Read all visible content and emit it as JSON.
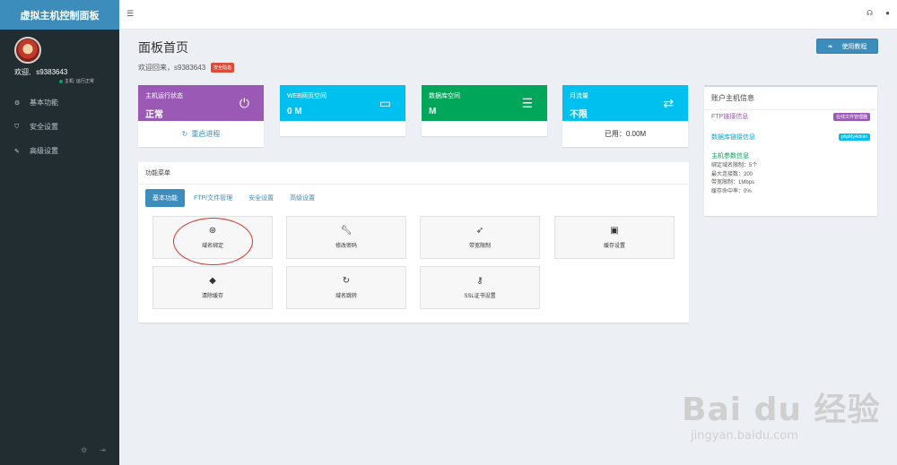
{
  "brand": "虚拟主机控制面板",
  "user": {
    "welcome": "欢迎,",
    "name": "s9383643",
    "status": "主机: 运行正常"
  },
  "sidebar": {
    "items": [
      {
        "label": "基本功能",
        "icon": "gears-icon"
      },
      {
        "label": "安全设置",
        "icon": "shield-icon"
      },
      {
        "label": "高级设置",
        "icon": "edit-icon"
      }
    ],
    "footer_icons": [
      "gear-icon",
      "logout-icon"
    ]
  },
  "header": {
    "menu_icon": "hamburger-icon",
    "right_icons": [
      "headset-icon",
      "user-icon"
    ]
  },
  "page": {
    "title": "面板首页",
    "subtitle": "欢迎回来，s9383643",
    "security_badge": "安全隐患",
    "tutorial_button": "使用教程"
  },
  "stats": [
    {
      "label": "主机运行状态",
      "value": "正常",
      "icon": "power-icon",
      "color": "#9b59b6",
      "footer": "重启进程"
    },
    {
      "label": "WEB网页空间",
      "value": "0 M",
      "icon": "hdd-icon",
      "color": "#00c0ef",
      "footer": ""
    },
    {
      "label": "数据库空间",
      "value": "M",
      "icon": "database-icon",
      "color": "#00a65a",
      "footer": ""
    },
    {
      "label": "月流量",
      "value": "不限",
      "icon": "exchange-icon",
      "color": "#00c0ef",
      "footer": "已用：0.00M"
    }
  ],
  "account": {
    "title": "账户主机信息",
    "ftp_label": "FTP链接信息",
    "ftp_tag": "在线文件管理器",
    "db_label": "数据库链接信息",
    "db_tag": "phpMyAdmin",
    "params_title": "主机参数信息",
    "params": [
      "绑定域名限制：5个",
      "最大连接数：200",
      "带宽限制：1Mbps",
      "缓存命中率：0%"
    ]
  },
  "functions": {
    "title": "功能菜单",
    "tabs": [
      "基本功能",
      "FTP/文件管理",
      "安全设置",
      "高级设置"
    ],
    "tiles": [
      {
        "label": "域名绑定",
        "icon": "dribbble-icon"
      },
      {
        "label": "修改密码",
        "icon": "wrench-icon"
      },
      {
        "label": "带宽限制",
        "icon": "rocket-icon"
      },
      {
        "label": "缓存设置",
        "icon": "save-icon"
      },
      {
        "label": "清除缓存",
        "icon": "eraser-icon"
      },
      {
        "label": "域名跳转",
        "icon": "refresh-icon"
      },
      {
        "label": "SSL证书设置",
        "icon": "key-icon"
      }
    ]
  },
  "watermark": {
    "logo": "Bai du 经验",
    "url": "jingyan.baidu.com"
  }
}
